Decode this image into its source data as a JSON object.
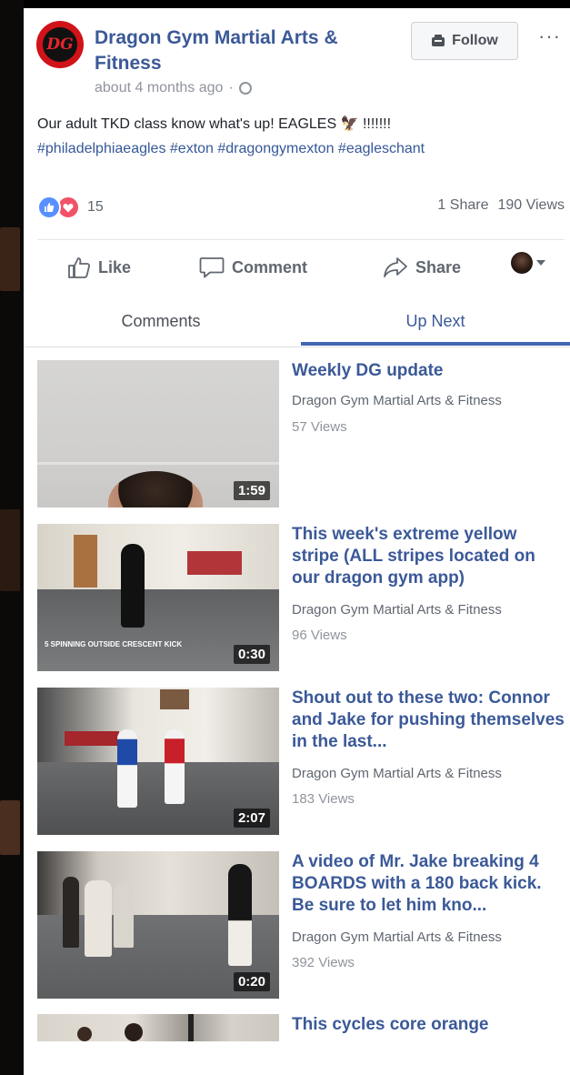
{
  "post": {
    "page_name": "Dragon Gym Martial Arts & Fitness",
    "avatar_text": "DG",
    "timestamp": "about 4 months ago",
    "follow_label": "Follow",
    "more_label": "···",
    "caption_text": "Our adult TKD class know what's up! EAGLES 🦅 !!!!!!!",
    "caption_tags": "#philadelphiaeagles #exton #dragongymexton #eagleschant"
  },
  "reactions": {
    "count": "15",
    "shares": "1 Share",
    "views": "190 Views"
  },
  "actions": {
    "like": "Like",
    "comment": "Comment",
    "share": "Share"
  },
  "tabs": {
    "comments": "Comments",
    "up_next": "Up Next"
  },
  "videos": [
    {
      "title": "Weekly DG update",
      "author": "Dragon Gym Martial Arts & Fitness",
      "views": "57 Views",
      "duration": "1:59"
    },
    {
      "title": "This week's extreme yellow stripe (ALL stripes located on our dragon gym app)",
      "author": "Dragon Gym Martial Arts & Fitness",
      "views": "96 Views",
      "duration": "0:30"
    },
    {
      "title": "Shout out to these two: Connor and Jake for pushing themselves in the last...",
      "author": "Dragon Gym Martial Arts & Fitness",
      "views": "183 Views",
      "duration": "2:07"
    },
    {
      "title": "A video of Mr. Jake breaking 4 BOARDS with a 180 back kick. Be sure to let him kno...",
      "author": "Dragon Gym Martial Arts & Fitness",
      "views": "392 Views",
      "duration": "0:20"
    },
    {
      "title": "This cycles core orange",
      "author": "",
      "views": "",
      "duration": ""
    }
  ],
  "thumb_overlay": "5 SPINNING OUTSIDE CRESCENT KICK",
  "colors": {
    "link_blue": "#3b5998",
    "tab_underline": "#4267b2",
    "brand_red": "#d01219"
  }
}
